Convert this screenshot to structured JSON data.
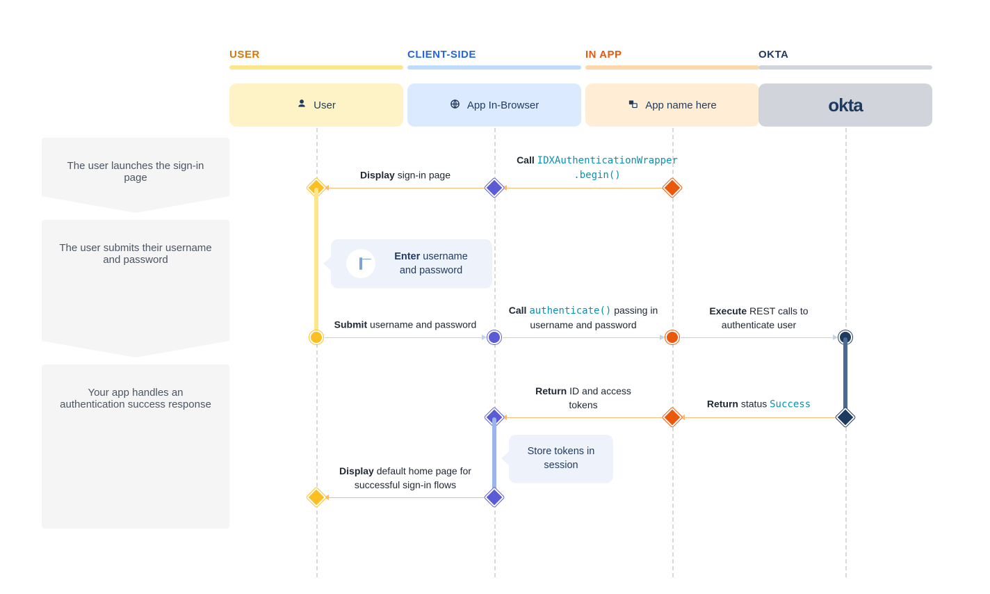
{
  "lanes": {
    "user": {
      "heading": "USER",
      "card": "User"
    },
    "client": {
      "heading": "CLIENT-SIDE",
      "card": "App In-Browser"
    },
    "app": {
      "heading": "IN APP",
      "card": "App name here"
    },
    "okta": {
      "heading": "OKTA",
      "card": "okta"
    }
  },
  "steps": [
    "The user launches the sign-in page",
    "The user submits their username and password",
    "Your app handles an authentication success response"
  ],
  "messages": {
    "m1_call_begin": {
      "bold": "Call",
      "code": "IDXAuthenticationWrapper",
      "code2": ".begin()"
    },
    "m2_display_signin": {
      "bold": "Display",
      "rest": " sign-in page"
    },
    "m3_enter_creds": {
      "bold": "Enter",
      "rest": " username and password"
    },
    "m4_submit": {
      "bold": "Submit",
      "rest": " username and password"
    },
    "m5_call_auth": {
      "bold": "Call",
      "code": "authenticate()",
      "rest": " passing in username and password"
    },
    "m6_exec": {
      "bold": "Execute",
      "rest": " REST calls to authenticate user"
    },
    "m7_return_status": {
      "bold": "Return",
      "rest": " status ",
      "code": "Success"
    },
    "m8_return_tokens": {
      "bold": "Return",
      "rest": " ID and access tokens"
    },
    "m9_store": {
      "text": "Store tokens in session"
    },
    "m10_display_home": {
      "bold": "Display",
      "rest": " default home page for successful sign-in flows"
    }
  }
}
